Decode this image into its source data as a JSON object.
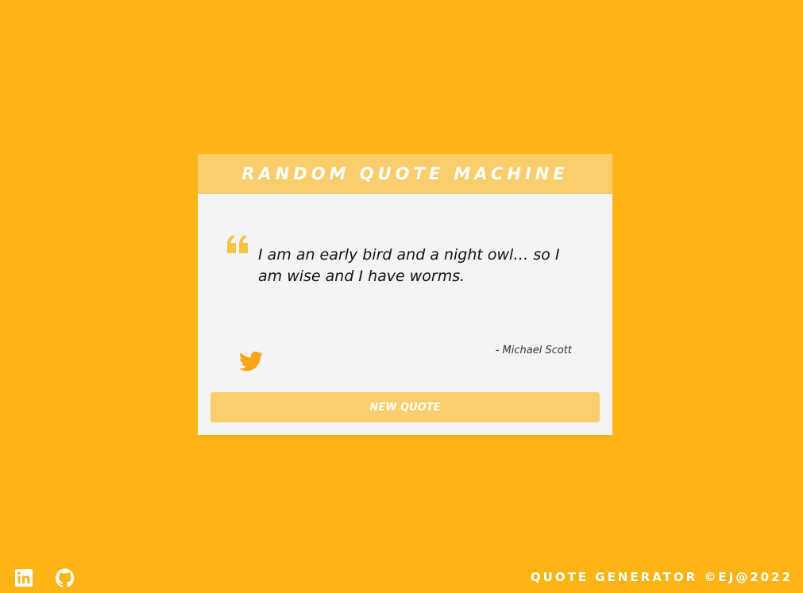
{
  "colors": {
    "background": "#FDB414",
    "accent": "#F9CD6B",
    "card": "#F4F4F4",
    "quote_icon": "#F8C244",
    "twitter_icon": "#F5A619",
    "text": "#111111"
  },
  "card": {
    "title": "RANDOM QUOTE MACHINE",
    "quote_icon": "quote-left-icon",
    "quote": "I am an early bird and a night owl… so I am wise and I have worms.",
    "author": "- Michael Scott",
    "tweet_icon": "twitter-icon",
    "new_quote_label": "NEW QUOTE"
  },
  "footer": {
    "social": [
      {
        "icon": "linkedin-icon"
      },
      {
        "icon": "github-icon"
      }
    ],
    "text": "QUOTE GENERATOR ©EJ@2022"
  }
}
